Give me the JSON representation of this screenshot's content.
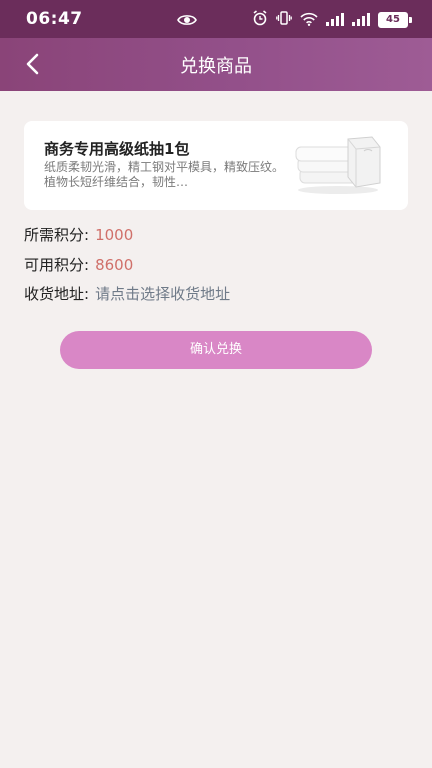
{
  "status_bar": {
    "time": "06:47",
    "battery": "45"
  },
  "header": {
    "title": "兑换商品"
  },
  "product": {
    "name": "商务专用高级纸抽1包",
    "description": "纸质柔韧光滑，精工钢对平模具，精致压纹。植物长短纤维结合，韧性…"
  },
  "points": {
    "required_label": "所需积分:",
    "required_value": "1000",
    "available_label": "可用积分:",
    "available_value": "8600",
    "address_label": "收货地址:",
    "address_placeholder": "请点击选择收货地址"
  },
  "actions": {
    "confirm_label": "确认兑换"
  },
  "colors": {
    "status_bar": "#6b2d5b",
    "nav_bar": "#8a4478",
    "background": "#f4f0ef",
    "points_value": "#d0706a",
    "button": "#d987c6"
  }
}
